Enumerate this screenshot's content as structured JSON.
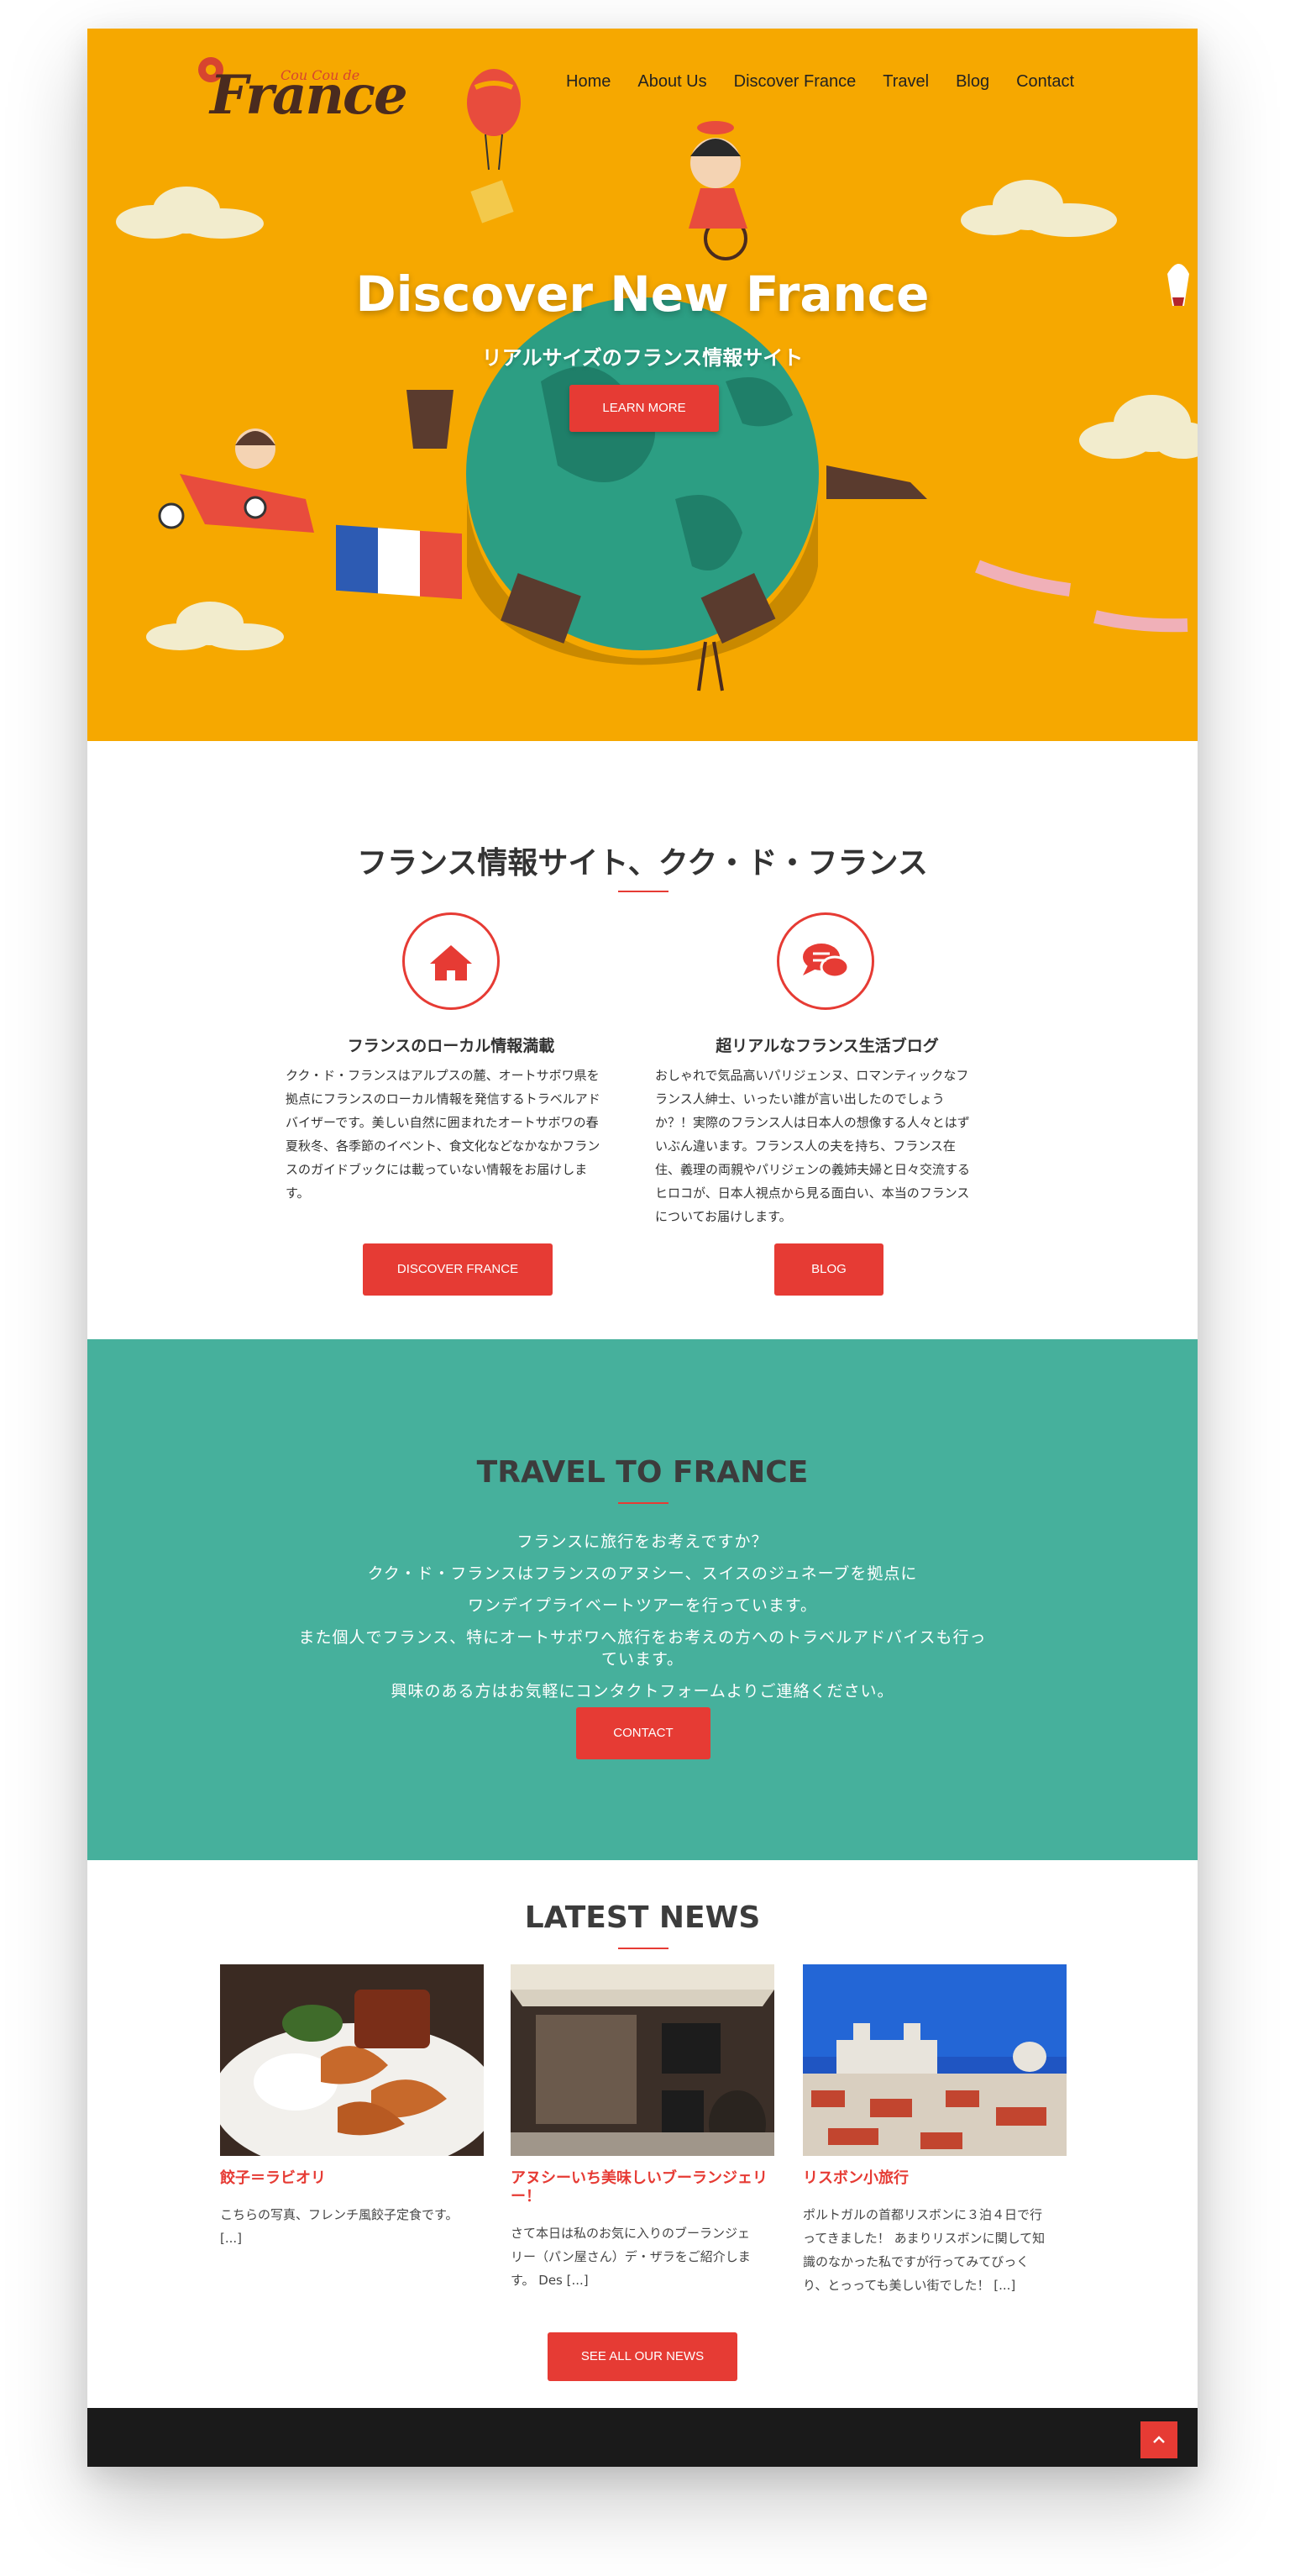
{
  "brand": {
    "logo_small": "Cou Cou de",
    "logo_big": "France"
  },
  "nav": {
    "items": [
      "Home",
      "About Us",
      "Discover France",
      "Travel",
      "Blog",
      "Contact"
    ]
  },
  "hero": {
    "title": "Discover New France",
    "subtitle": "リアルサイズのフランス情報サイト",
    "button": "LEARN MORE"
  },
  "intro": {
    "title": "フランス情報サイト、クク・ド・フランス",
    "features": [
      {
        "icon": "home-icon",
        "title": "フランスのローカル情報満載",
        "lines": [
          "クク・ド・フランスはアルプスの麓、オートサボワ県を",
          "拠点にフランスのローカル情報を発信するトラベルアド",
          "バイザーです。美しい自然に囲まれたオートサボワの春",
          "夏秋冬、各季節のイベント、食文化などなかなかフラン",
          "スのガイドブックには載っていない情報をお届けしま",
          "す。"
        ],
        "button": "DISCOVER FRANCE"
      },
      {
        "icon": "chat-icon",
        "title": "超リアルなフランス生活ブログ",
        "lines": [
          "おしゃれで気品高いパリジェンヌ、ロマンティックなフ",
          "ランス人紳士、いったい誰が言い出したのでしょう",
          "か？！実際のフランス人は日本人の想像する人々とはず",
          "いぶん違います。フランス人の夫を持ち、フランス在",
          "住、義理の両親やパリジェンの義姉夫婦と日々交流する",
          "ヒロコが、日本人視点から見る面白い、本当のフランス",
          "についてお届けします。"
        ],
        "button": "BLOG"
      }
    ]
  },
  "travel": {
    "title": "TRAVEL TO FRANCE",
    "lines": [
      "フランスに旅行をお考えですか？",
      "クク・ド・フランスはフランスのアヌシー、スイスのジュネーブを拠点に",
      "ワンデイプライベートツアーを行っています。",
      "また個人でフランス、特にオートサボワへ旅行をお考えの方へのトラベルアドバイスも行っ",
      "ています。",
      "興味のある方はお気軽にコンタクトフォームよりご連絡ください。"
    ],
    "button": "CONTACT"
  },
  "news": {
    "title": "LATEST NEWS",
    "items": [
      {
        "title": "餃子＝ラビオリ",
        "excerpt": [
          "こちらの写真、フレンチ風餃子定食です。",
          "[...]"
        ]
      },
      {
        "title": "アヌシーいち美味しいブーランジェリー！",
        "excerpt": [
          "さて本日は私のお気に入りのブーランジェ",
          "リー（パン屋さん）デ・ザラをご紹介しま",
          "す。 Des [...]"
        ]
      },
      {
        "title": "リスボン小旅行",
        "excerpt": [
          "ポルトガルの首都リスボンに３泊４日で行",
          "ってきました！ あまりリスボンに関して知",
          "識のなかった私ですが行ってみてびっく",
          "り、とっっても美しい街でした！ [...]"
        ]
      }
    ],
    "button": "SEE ALL OUR NEWS"
  },
  "colors": {
    "hero_bg": "#f6a800",
    "accent": "#e63b34",
    "travel_bg": "#46b09c",
    "footer_bg": "#1a1a1a"
  }
}
